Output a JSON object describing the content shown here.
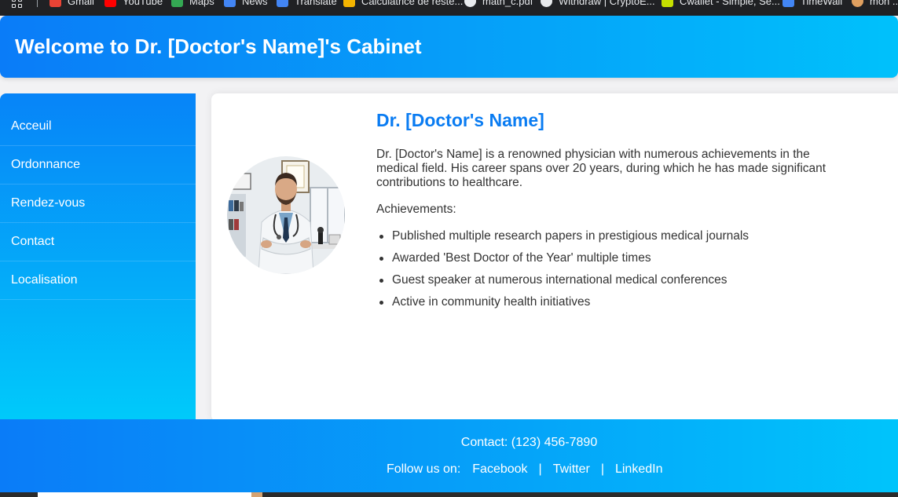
{
  "bookmarks": [
    {
      "label": "Gmail",
      "icon": "gmail-icon",
      "color": "#ea4335"
    },
    {
      "label": "YouTube",
      "icon": "youtube-icon",
      "color": "#ff0000"
    },
    {
      "label": "Maps",
      "icon": "maps-icon",
      "color": "#34a853"
    },
    {
      "label": "News",
      "icon": "news-icon",
      "color": "#4285f4"
    },
    {
      "label": "Translate",
      "icon": "translate-icon",
      "color": "#4285f4"
    },
    {
      "label": "Calculatrice de reste...",
      "icon": "calculator-icon",
      "color": "#f4b400"
    },
    {
      "label": "math_c.pdf",
      "icon": "globe-icon",
      "color": "#e8eaed"
    },
    {
      "label": "Withdraw | CryptoE...",
      "icon": "globe-icon",
      "color": "#e8eaed"
    },
    {
      "label": "Cwallet - Simple, Se...",
      "icon": "cwallet-icon",
      "color": "#c6e000"
    },
    {
      "label": "TimeWall",
      "icon": "timewall-icon",
      "color": "#4285f4"
    },
    {
      "label": "mon ..",
      "icon": "profile-icon",
      "color": "#e0a060"
    }
  ],
  "header": {
    "title": "Welcome to Dr. [Doctor's Name]'s Cabinet"
  },
  "nav": [
    {
      "label": "Acceuil"
    },
    {
      "label": "Ordonnance"
    },
    {
      "label": "Rendez-vous"
    },
    {
      "label": "Contact"
    },
    {
      "label": "Localisation"
    }
  ],
  "profile": {
    "name": "Dr. [Doctor's Name]",
    "bio": "Dr. [Doctor's Name] is a renowned physician with numerous achievements in the medical field. His career spans over 20 years, during which he has made significant contributions to healthcare.",
    "achievements_label": "Achievements:",
    "achievements": [
      "Published multiple research papers in prestigious medical journals",
      "Awarded 'Best Doctor of the Year' multiple times",
      "Guest speaker at numerous international medical conferences",
      "Active in community health initiatives"
    ]
  },
  "footer": {
    "contact": "Contact: (123) 456-7890",
    "follow_label": "Follow us on:",
    "links": [
      "Facebook",
      "Twitter",
      "LinkedIn"
    ],
    "separator": "|"
  },
  "colors": {
    "accent": "#0a7cf2",
    "gradient_start": "#0a7cf8",
    "gradient_end": "#00c4fb"
  }
}
